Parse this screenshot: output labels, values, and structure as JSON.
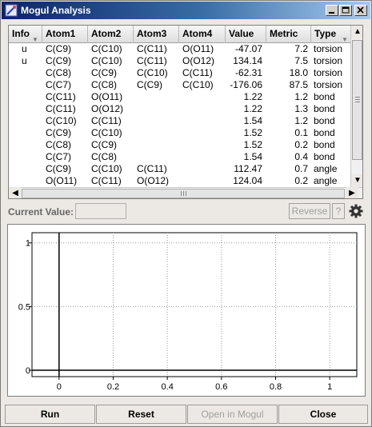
{
  "window": {
    "title": "Mogul Analysis",
    "controls": [
      "minimize",
      "maximize",
      "close"
    ]
  },
  "table": {
    "columns": [
      {
        "label": "Info",
        "sort": true
      },
      {
        "label": "Atom1"
      },
      {
        "label": "Atom2"
      },
      {
        "label": "Atom3"
      },
      {
        "label": "Atom4"
      },
      {
        "label": "Value"
      },
      {
        "label": "Metric"
      },
      {
        "label": "Type",
        "sort": true
      }
    ],
    "rows": [
      [
        "u",
        "C(C9)",
        "C(C10)",
        "C(C11)",
        "O(O11)",
        "-47.07",
        "7.2",
        "torsion"
      ],
      [
        "u",
        "C(C9)",
        "C(C10)",
        "C(C11)",
        "O(O12)",
        "134.14",
        "7.5",
        "torsion"
      ],
      [
        "",
        "C(C8)",
        "C(C9)",
        "C(C10)",
        "C(C11)",
        "-62.31",
        "18.0",
        "torsion"
      ],
      [
        "",
        "C(C7)",
        "C(C8)",
        "C(C9)",
        "C(C10)",
        "-176.06",
        "87.5",
        "torsion"
      ],
      [
        "",
        "C(C11)",
        "O(O11)",
        "",
        "",
        "1.22",
        "1.2",
        "bond"
      ],
      [
        "",
        "C(C11)",
        "O(O12)",
        "",
        "",
        "1.22",
        "1.3",
        "bond"
      ],
      [
        "",
        "C(C10)",
        "C(C11)",
        "",
        "",
        "1.54",
        "1.2",
        "bond"
      ],
      [
        "",
        "C(C9)",
        "C(C10)",
        "",
        "",
        "1.52",
        "0.1",
        "bond"
      ],
      [
        "",
        "C(C8)",
        "C(C9)",
        "",
        "",
        "1.52",
        "0.2",
        "bond"
      ],
      [
        "",
        "C(C7)",
        "C(C8)",
        "",
        "",
        "1.54",
        "0.4",
        "bond"
      ],
      [
        "",
        "C(C9)",
        "C(C10)",
        "C(C11)",
        "",
        "112.47",
        "0.7",
        "angle"
      ],
      [
        "",
        "O(O11)",
        "C(C11)",
        "O(O12)",
        "",
        "124.04",
        "0.2",
        "angle"
      ]
    ]
  },
  "current_value": {
    "label": "Current Value:",
    "value": ""
  },
  "toolbar": {
    "reverse_label": "Reverse",
    "help_label": "?",
    "settings_icon": "gear-icon"
  },
  "chart_data": {
    "type": "scatter",
    "x_ticks": [
      "0",
      "0.2",
      "0.4",
      "0.6",
      "0.8",
      "1"
    ],
    "y_ticks": [
      "0",
      "0.5",
      "1"
    ],
    "xlim": [
      -0.1,
      1.1
    ],
    "ylim": [
      -0.05,
      1.08
    ],
    "grid": true,
    "series": []
  },
  "buttons": {
    "run": "Run",
    "reset": "Reset",
    "open_in_mogul": "Open in Mogul",
    "close": "Close"
  }
}
